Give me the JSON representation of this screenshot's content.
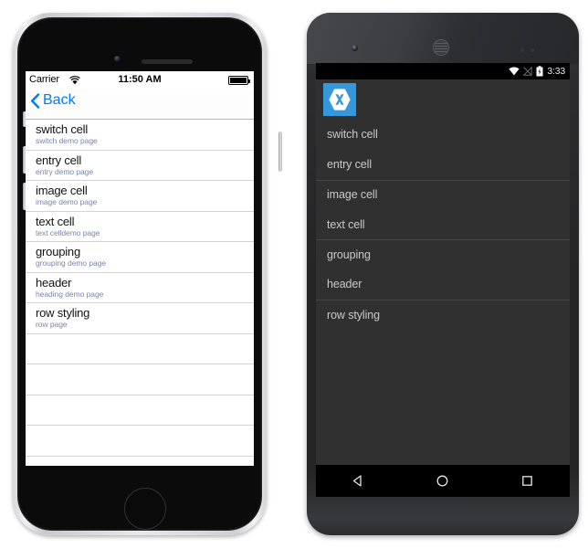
{
  "ios": {
    "status": {
      "carrier": "Carrier",
      "wifi_icon": "wifi-icon",
      "time": "11:50 AM",
      "battery_icon": "battery-full-icon"
    },
    "navbar": {
      "back_label": "Back",
      "back_icon": "chevron-left-icon"
    },
    "list": [
      {
        "title": "switch cell",
        "subtitle": "switch demo page"
      },
      {
        "title": "entry cell",
        "subtitle": "entry demo page"
      },
      {
        "title": "image cell",
        "subtitle": "image demo page"
      },
      {
        "title": "text cell",
        "subtitle": "text celldemo page"
      },
      {
        "title": "grouping",
        "subtitle": "grouping demo page"
      },
      {
        "title": "header",
        "subtitle": "heading demo page"
      },
      {
        "title": "row styling",
        "subtitle": "row page"
      }
    ],
    "empty_row_count": 5
  },
  "android": {
    "status": {
      "wifi_icon": "wifi-icon",
      "signal_icon": "signal-no-service-icon",
      "battery_icon": "battery-charging-icon",
      "time": "3:33"
    },
    "actionbar": {
      "app_icon": "xamarin-logo-icon"
    },
    "list": [
      {
        "label": "switch cell",
        "separator": false
      },
      {
        "label": "entry cell",
        "separator": false
      },
      {
        "label": "image cell",
        "separator": true
      },
      {
        "label": "text cell",
        "separator": false
      },
      {
        "label": "grouping",
        "separator": true
      },
      {
        "label": "header",
        "separator": false
      },
      {
        "label": "row styling",
        "separator": true
      }
    ],
    "navbar": {
      "back_icon": "nav-back-triangle-icon",
      "home_icon": "nav-home-circle-icon",
      "recents_icon": "nav-recents-square-icon"
    }
  },
  "colors": {
    "ios_accent": "#007AFF",
    "ios_subtitle": "#7B85AB",
    "android_bg": "#303030",
    "xamarin_blue": "#3498DB"
  }
}
